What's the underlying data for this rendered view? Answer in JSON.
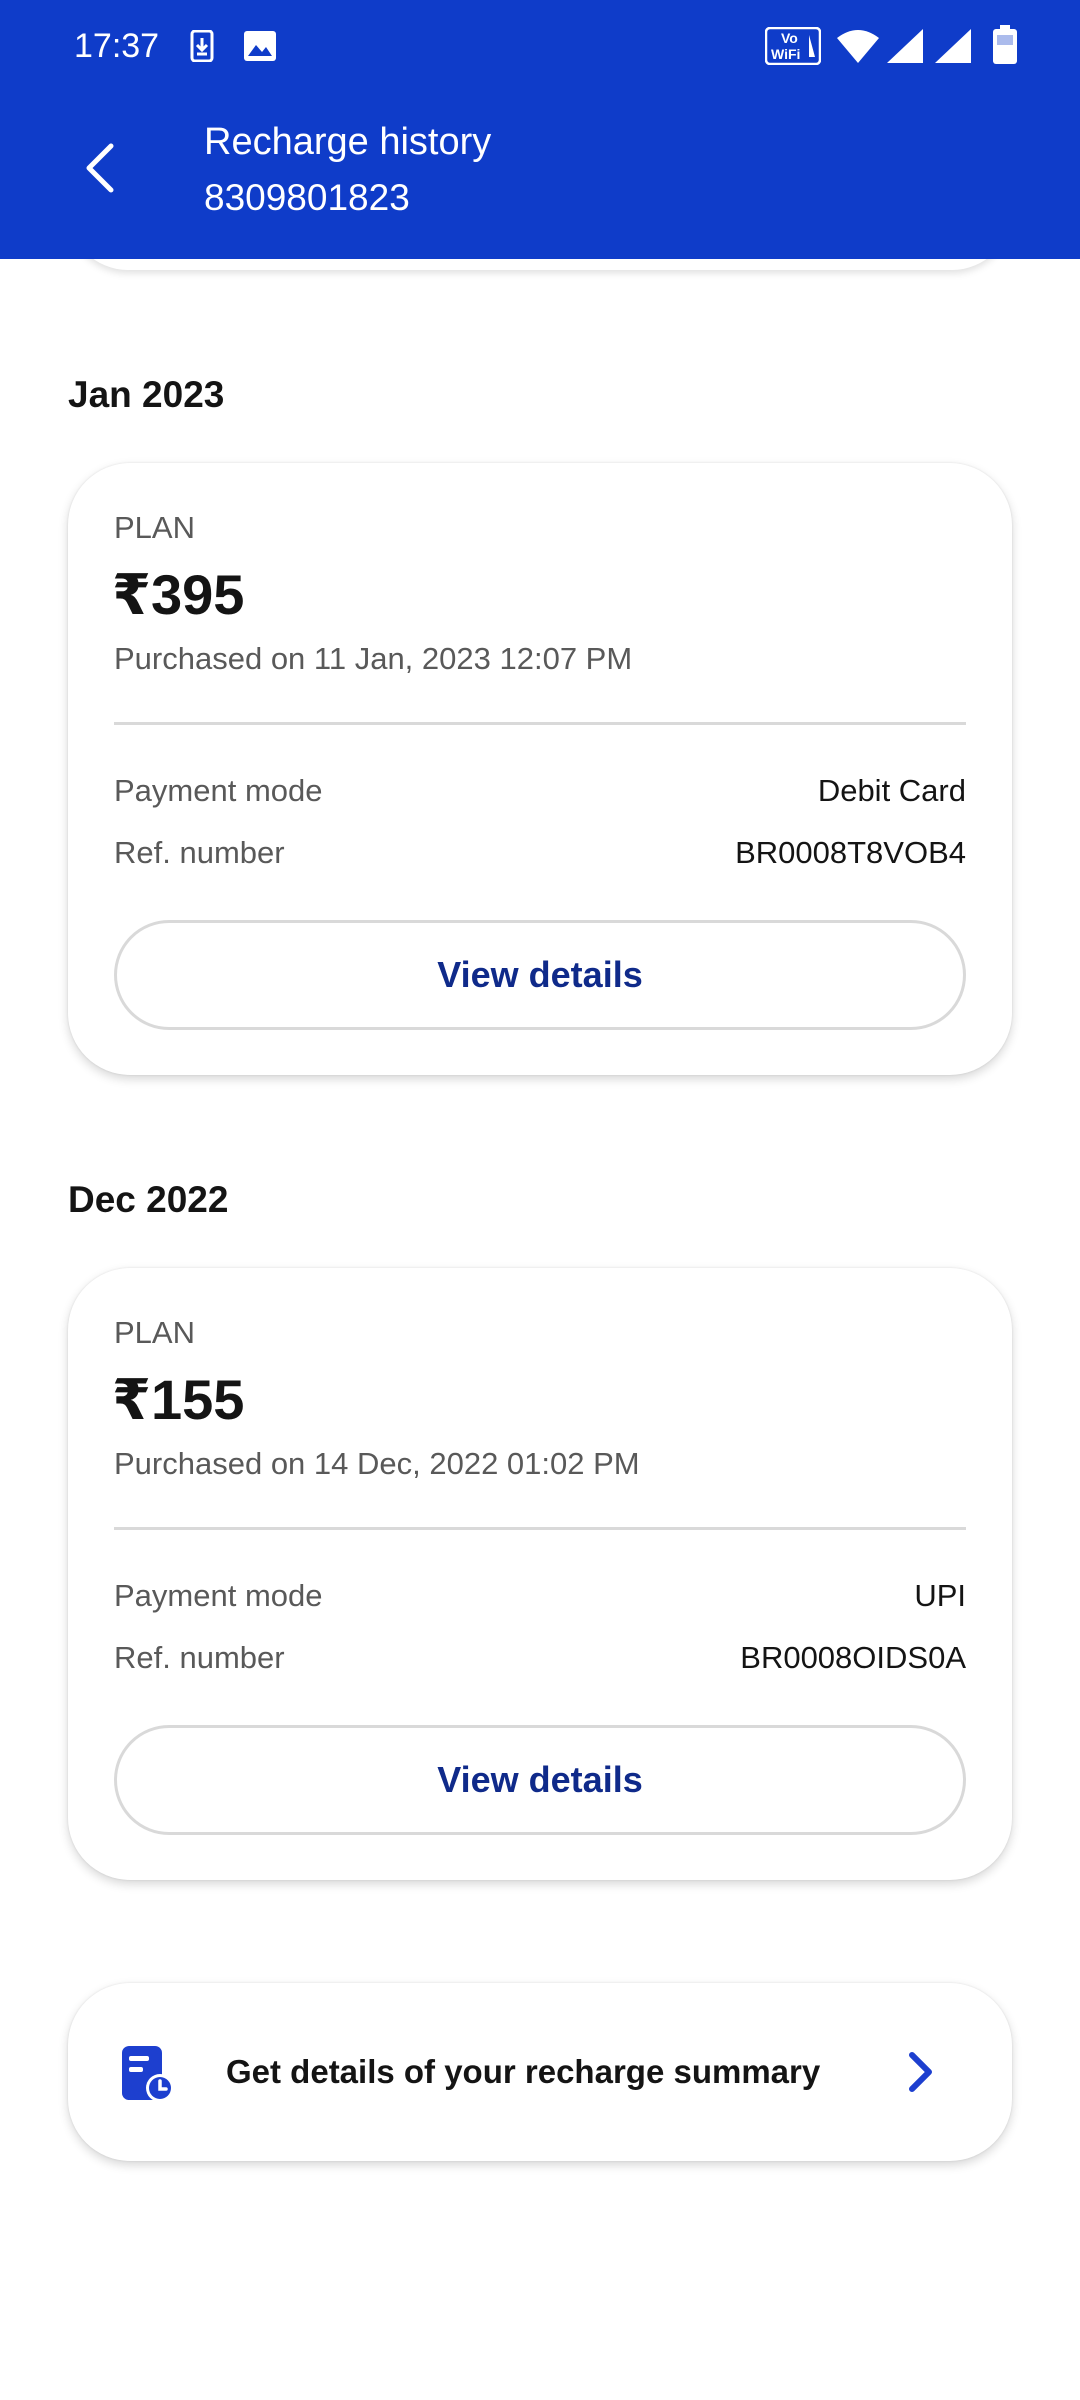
{
  "status_bar": {
    "time": "17:37",
    "icons": [
      "download-icon",
      "image-icon",
      "vowifi-icon",
      "wifi-icon",
      "signal-icon",
      "signal-icon",
      "battery-icon"
    ],
    "vowifi_text_top": "Vo",
    "vowifi_text_bottom": "WiFi"
  },
  "header": {
    "title": "Recharge history",
    "subtitle": "8309801823",
    "back_icon": "chevron-left-icon",
    "background": "#0f3cc9"
  },
  "recharges": [
    {
      "month": "Jan 2023",
      "plan_label": "PLAN",
      "amount": "₹395",
      "purchased": "Purchased on 11 Jan, 2023 12:07 PM",
      "payment_mode_label": "Payment mode",
      "payment_mode": "Debit Card",
      "ref_label": "Ref. number",
      "ref_number": "BR0008T8VOB4",
      "button_label": "View details"
    },
    {
      "month": "Dec 2022",
      "plan_label": "PLAN",
      "amount": "₹155",
      "purchased": "Purchased on 14 Dec, 2022 01:02 PM",
      "payment_mode_label": "Payment mode",
      "payment_mode": "UPI",
      "ref_label": "Ref. number",
      "ref_number": "BR0008OIDS0A",
      "button_label": "View details"
    }
  ],
  "summary": {
    "icon": "recharge-summary-icon",
    "text": "Get details of your recharge summary",
    "chevron_icon": "chevron-right-icon",
    "accent": "#1d3fcf"
  }
}
